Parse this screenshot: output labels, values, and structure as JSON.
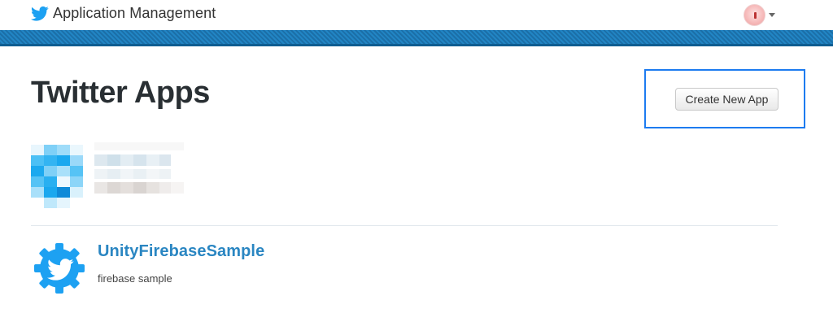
{
  "header": {
    "title": "Application Management",
    "logo_icon": "twitter-bird-icon",
    "user_menu": {
      "avatar_icon": "user-avatar",
      "caret_icon": "chevron-down-icon"
    }
  },
  "banner": {
    "accent": "#2285c4"
  },
  "main": {
    "page_title": "Twitter Apps",
    "create_button_label": "Create New App",
    "highlight_color": "#1d7bf0",
    "apps": [
      {
        "name": "UnityFirebaseSample",
        "description": "firebase sample",
        "icon": "app-gear-icon"
      }
    ]
  },
  "colors": {
    "link": "#2a86c2",
    "title": "#292f33",
    "divider": "#e1e8ed"
  }
}
